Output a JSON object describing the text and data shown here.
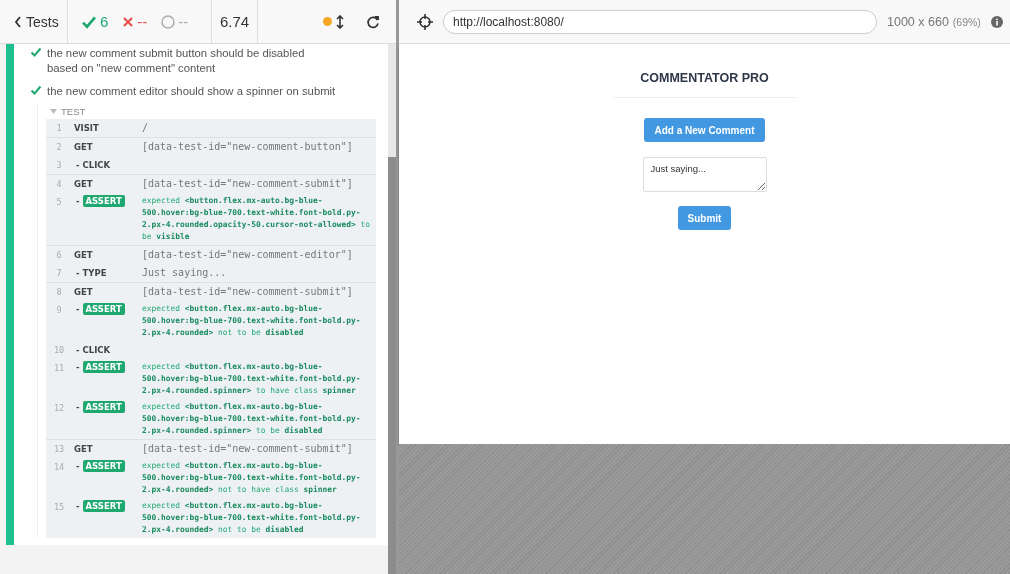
{
  "reporter": {
    "back_label": "Tests",
    "stats": [
      {
        "kind": "passed",
        "count": "6"
      },
      {
        "kind": "failed",
        "count": "--"
      },
      {
        "kind": "pending",
        "count": "--"
      }
    ],
    "duration": "6.74",
    "tests": [
      {
        "passed": true,
        "title": "the new comment submit button should be disabled based on \"new comment\" content"
      },
      {
        "passed": true,
        "title": "the new comment editor should show a spinner on submit"
      }
    ],
    "hook": {
      "label": "TEST",
      "expanded": true
    },
    "command_groups": [
      [
        {
          "number": "1",
          "kind": "command",
          "name": "VISIT",
          "message": "/"
        }
      ],
      [
        {
          "number": "2",
          "kind": "command",
          "name": "GET",
          "message": "[data-test-id=\"new-comment-button\"]"
        },
        {
          "number": "3",
          "kind": "child",
          "name": "- CLICK"
        }
      ],
      [
        {
          "number": "4",
          "kind": "command",
          "name": "GET",
          "message": "[data-test-id=\"new-comment-submit\"]"
        },
        {
          "number": "5",
          "kind": "assert",
          "dash": "-",
          "name": "ASSERT",
          "message": "expected **<button.flex.mx-auto.bg-blue-500.hover:bg-blue-700.text-white.font-bold.py-2.px-4.rounded.opacity-50.cursor-not-allowed>** to be **visible**"
        }
      ],
      [
        {
          "number": "6",
          "kind": "command",
          "name": "GET",
          "message": "[data-test-id=\"new-comment-editor\"]"
        },
        {
          "number": "7",
          "kind": "child",
          "name": "- TYPE",
          "message": "Just saying..."
        }
      ],
      [
        {
          "number": "8",
          "kind": "command",
          "name": "GET",
          "message": "[data-test-id=\"new-comment-submit\"]"
        },
        {
          "number": "9",
          "kind": "assert",
          "dash": "-",
          "name": "ASSERT",
          "message": "expected **<button.flex.mx-auto.bg-blue-500.hover:bg-blue-700.text-white.font-bold.py-2.px-4.rounded>** not to be **disabled**"
        },
        {
          "number": "10",
          "kind": "child",
          "name": "- CLICK"
        },
        {
          "number": "11",
          "kind": "assert",
          "dash": "-",
          "name": "ASSERT",
          "message": "expected **<button.flex.mx-auto.bg-blue-500.hover:bg-blue-700.text-white.font-bold.py-2.px-4.rounded.spinner>** to have class **spinner**"
        },
        {
          "number": "12",
          "kind": "assert",
          "dash": "-",
          "name": "ASSERT",
          "message": "expected **<button.flex.mx-auto.bg-blue-500.hover:bg-blue-700.text-white.font-bold.py-2.px-4.rounded.spinner>** to be **disabled**"
        }
      ],
      [
        {
          "number": "13",
          "kind": "command",
          "name": "GET",
          "message": "[data-test-id=\"new-comment-submit\"]"
        },
        {
          "number": "14",
          "kind": "assert",
          "dash": "-",
          "name": "ASSERT",
          "message": "expected **<button.flex.mx-auto.bg-blue-500.hover:bg-blue-700.text-white.font-bold.py-2.px-4.rounded>** not to have class **spinner**"
        },
        {
          "number": "15",
          "kind": "assert",
          "dash": "-",
          "name": "ASSERT",
          "message": "expected **<button.flex.mx-auto.bg-blue-500.hover:bg-blue-700.text-white.font-bold.py-2.px-4.rounded>** not to be **disabled**"
        }
      ]
    ]
  },
  "browser": {
    "url": "http://localhost:8080/",
    "viewport": "1000 x 660",
    "scale": "(69%)",
    "app": {
      "title": "COMMENTATOR PRO",
      "add_button": "Add a New Comment",
      "editor_value": "Just saying...",
      "submit_button": "Submit"
    }
  }
}
